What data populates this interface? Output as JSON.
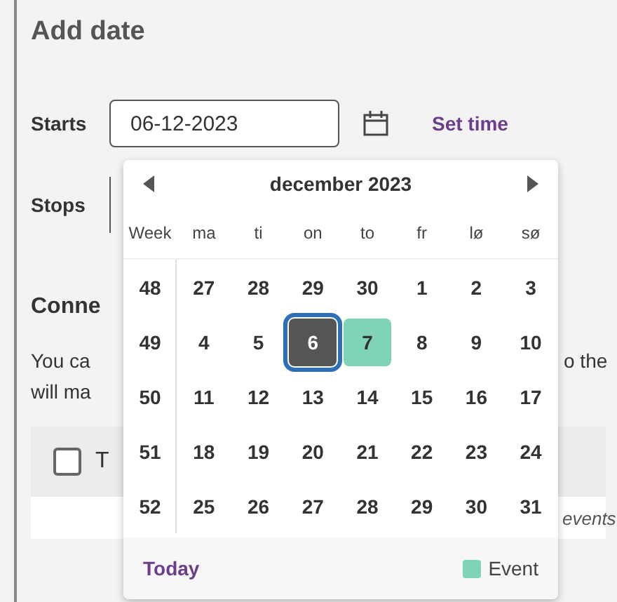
{
  "heading": "Add date",
  "starts": {
    "label": "Starts",
    "value": "06-12-2023",
    "link": "Set time"
  },
  "stops": {
    "label": "Stops"
  },
  "section": {
    "heading": "Conne",
    "lines": [
      "You ca",
      "will ma"
    ],
    "tail": "o the"
  },
  "table": {
    "checkbox": {
      "checked": false,
      "label": "T"
    },
    "row_text": "events"
  },
  "calendar": {
    "month": "december 2023",
    "week_header": "Week",
    "weekdays": [
      "ma",
      "ti",
      "on",
      "to",
      "fr",
      "lø",
      "sø"
    ],
    "weeks": [
      {
        "week": "48",
        "days": [
          {
            "day": "27",
            "selected": false,
            "event": false
          },
          {
            "day": "28",
            "selected": false,
            "event": false
          },
          {
            "day": "29",
            "selected": false,
            "event": false
          },
          {
            "day": "30",
            "selected": false,
            "event": false
          },
          {
            "day": "1",
            "selected": false,
            "event": false
          },
          {
            "day": "2",
            "selected": false,
            "event": false
          },
          {
            "day": "3",
            "selected": false,
            "event": false
          }
        ]
      },
      {
        "week": "49",
        "days": [
          {
            "day": "4",
            "selected": false,
            "event": false
          },
          {
            "day": "5",
            "selected": false,
            "event": false
          },
          {
            "day": "6",
            "selected": true,
            "event": false
          },
          {
            "day": "7",
            "selected": false,
            "event": true
          },
          {
            "day": "8",
            "selected": false,
            "event": false
          },
          {
            "day": "9",
            "selected": false,
            "event": false
          },
          {
            "day": "10",
            "selected": false,
            "event": false
          }
        ]
      },
      {
        "week": "50",
        "days": [
          {
            "day": "11",
            "selected": false,
            "event": false
          },
          {
            "day": "12",
            "selected": false,
            "event": false
          },
          {
            "day": "13",
            "selected": false,
            "event": false
          },
          {
            "day": "14",
            "selected": false,
            "event": false
          },
          {
            "day": "15",
            "selected": false,
            "event": false
          },
          {
            "day": "16",
            "selected": false,
            "event": false
          },
          {
            "day": "17",
            "selected": false,
            "event": false
          }
        ]
      },
      {
        "week": "51",
        "days": [
          {
            "day": "18",
            "selected": false,
            "event": false
          },
          {
            "day": "19",
            "selected": false,
            "event": false
          },
          {
            "day": "20",
            "selected": false,
            "event": false
          },
          {
            "day": "21",
            "selected": false,
            "event": false
          },
          {
            "day": "22",
            "selected": false,
            "event": false
          },
          {
            "day": "23",
            "selected": false,
            "event": false
          },
          {
            "day": "24",
            "selected": false,
            "event": false
          }
        ]
      },
      {
        "week": "52",
        "days": [
          {
            "day": "25",
            "selected": false,
            "event": false
          },
          {
            "day": "26",
            "selected": false,
            "event": false
          },
          {
            "day": "27",
            "selected": false,
            "event": false
          },
          {
            "day": "28",
            "selected": false,
            "event": false
          },
          {
            "day": "29",
            "selected": false,
            "event": false
          },
          {
            "day": "30",
            "selected": false,
            "event": false
          },
          {
            "day": "31",
            "selected": false,
            "event": false
          }
        ]
      }
    ],
    "today_link": "Today",
    "legend": "Event"
  }
}
